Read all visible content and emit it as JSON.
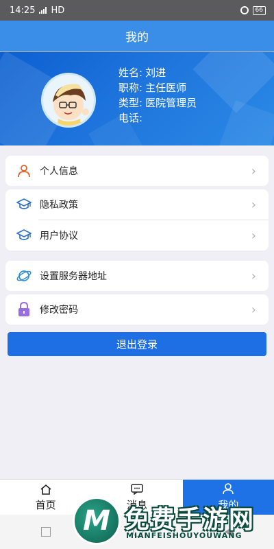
{
  "status_bar": {
    "time": "14:25",
    "network": "HD",
    "battery": "66"
  },
  "header": {
    "title": "我的"
  },
  "profile": {
    "name_label": "姓名:",
    "name_value": "刘进",
    "title_label": "职称:",
    "title_value": "主任医师",
    "type_label": "类型:",
    "type_value": "医院管理员",
    "phone_label": "电话:",
    "phone_value": ""
  },
  "menu": {
    "personal_info": "个人信息",
    "privacy_policy": "隐私政策",
    "user_agreement": "用户协议",
    "server_address": "设置服务器地址",
    "change_password": "修改密码",
    "chevron": "›"
  },
  "logout_label": "退出登录",
  "tabs": [
    {
      "label": "首页",
      "icon": "home-icon"
    },
    {
      "label": "消息",
      "icon": "message-icon"
    },
    {
      "label": "我的",
      "icon": "user-icon"
    }
  ],
  "colors": {
    "accent": "#1e72e6",
    "header": "#3a8ee8",
    "banner": "#1e74dc"
  },
  "watermark": {
    "logo": "M",
    "text": "免费手游网",
    "sub": "MIANFEISHOUYOUWANG"
  }
}
